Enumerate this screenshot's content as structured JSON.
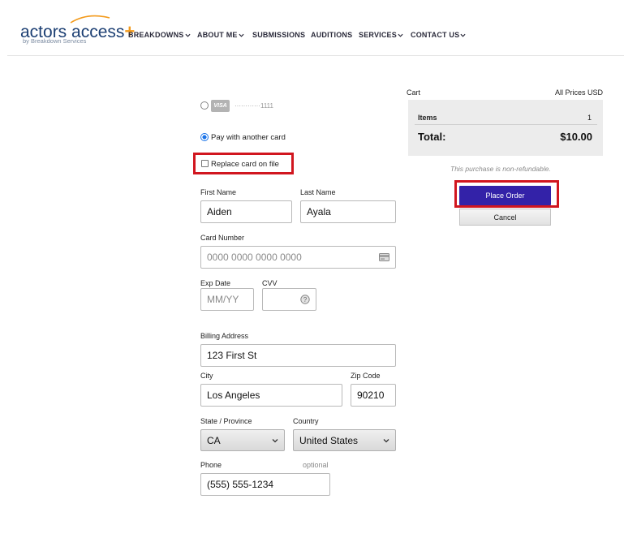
{
  "header": {
    "logo_text": "actors access",
    "logo_plus": "+",
    "logo_sub": "by Breakdown Services",
    "nav": [
      {
        "label": "BREAKDOWNS",
        "dropdown": true
      },
      {
        "label": "ABOUT ME",
        "dropdown": true
      },
      {
        "label": "SUBMISSIONS",
        "dropdown": false
      },
      {
        "label": "AUDITIONS",
        "dropdown": false
      },
      {
        "label": "SERVICES",
        "dropdown": true
      },
      {
        "label": "CONTACT US",
        "dropdown": true
      }
    ]
  },
  "payment": {
    "saved_card_brand": "VISA",
    "saved_card_mask": "············1111",
    "saved_card_selected": false,
    "other_card_label": "Pay with another card",
    "other_card_selected": true,
    "replace_card_label": "Replace card on file",
    "replace_card_checked": false
  },
  "form": {
    "first_name_label": "First Name",
    "first_name_value": "Aiden",
    "last_name_label": "Last Name",
    "last_name_value": "Ayala",
    "card_number_label": "Card Number",
    "card_number_placeholder": "0000 0000 0000 0000",
    "exp_label": "Exp Date",
    "exp_placeholder": "MM/YY",
    "cvv_label": "CVV",
    "address_label": "Billing Address",
    "address_value": "123 First St",
    "city_label": "City",
    "city_value": "Los Angeles",
    "zip_label": "Zip Code",
    "zip_value": "90210",
    "state_label": "State / Province",
    "state_value": "CA",
    "country_label": "Country",
    "country_value": "United States",
    "phone_label": "Phone",
    "phone_optional": "optional",
    "phone_value": "(555) 555-1234"
  },
  "cart": {
    "title": "Cart",
    "prices_note": "All Prices USD",
    "items_label": "Items",
    "items_count": "1",
    "total_label": "Total:",
    "total_value": "$10.00",
    "refund_note": "This purchase is non-refundable.",
    "place_order_label": "Place Order",
    "cancel_label": "Cancel"
  },
  "colors": {
    "highlight": "#d1161f",
    "primary_button": "#3322a8",
    "logo_blue": "#1c3f73",
    "logo_orange": "#f39a1b"
  }
}
